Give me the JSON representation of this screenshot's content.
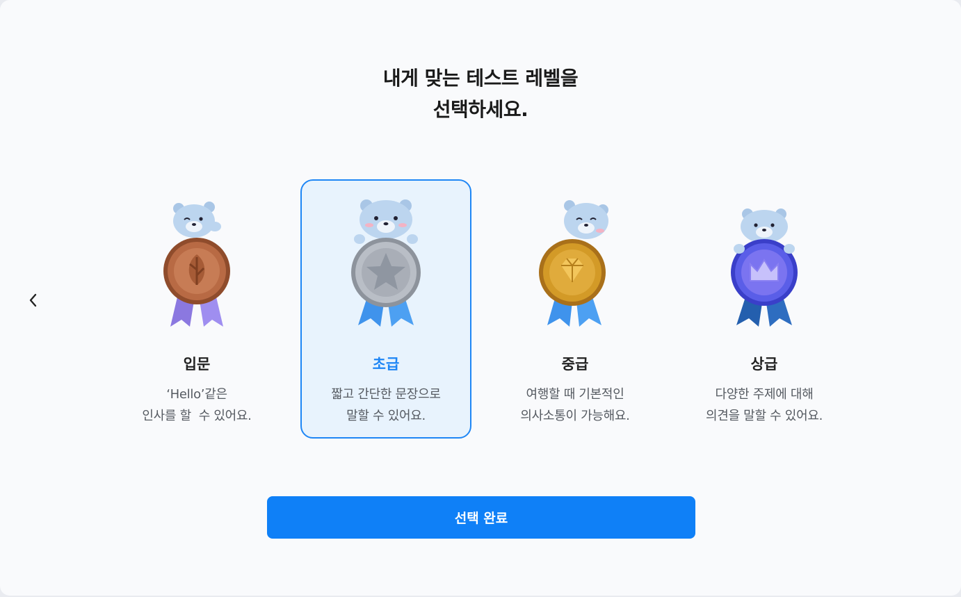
{
  "header": {
    "title_line1": "내게 맞는 테스트 레벨을",
    "title_line2": "선택하세요."
  },
  "nav": {
    "back_icon": "chevron-left-icon"
  },
  "levels": [
    {
      "label": "입문",
      "desc_line1": "‘Hello’같은",
      "desc_line2": "인사를 할  수 있어요.",
      "icon": "leaf-medal-icon",
      "medal_color": "#b86a44",
      "ribbon_color": "#8b78e0",
      "selected": false
    },
    {
      "label": "초급",
      "desc_line1": "짧고 간단한 문장으로",
      "desc_line2": "말할 수 있어요.",
      "icon": "star-medal-icon",
      "medal_color": "#a9aeb7",
      "ribbon_color": "#3f93ec",
      "selected": true
    },
    {
      "label": "중급",
      "desc_line1": "여행할 때 기본적인",
      "desc_line2": "의사소통이 가능해요.",
      "icon": "diamond-medal-icon",
      "medal_color": "#d39a27",
      "ribbon_color": "#3f93ec",
      "selected": false
    },
    {
      "label": "상급",
      "desc_line1": "다양한 주제에 대해",
      "desc_line2": "의견을 말할 수 있어요.",
      "icon": "crown-medal-icon",
      "medal_color": "#5a5ee8",
      "ribbon_color": "#245fae",
      "selected": false
    }
  ],
  "actions": {
    "submit_label": "선택 완료"
  },
  "colors": {
    "accent": "#1e86f5",
    "selected_bg": "#e8f3fd",
    "button": "#0f80f7"
  }
}
